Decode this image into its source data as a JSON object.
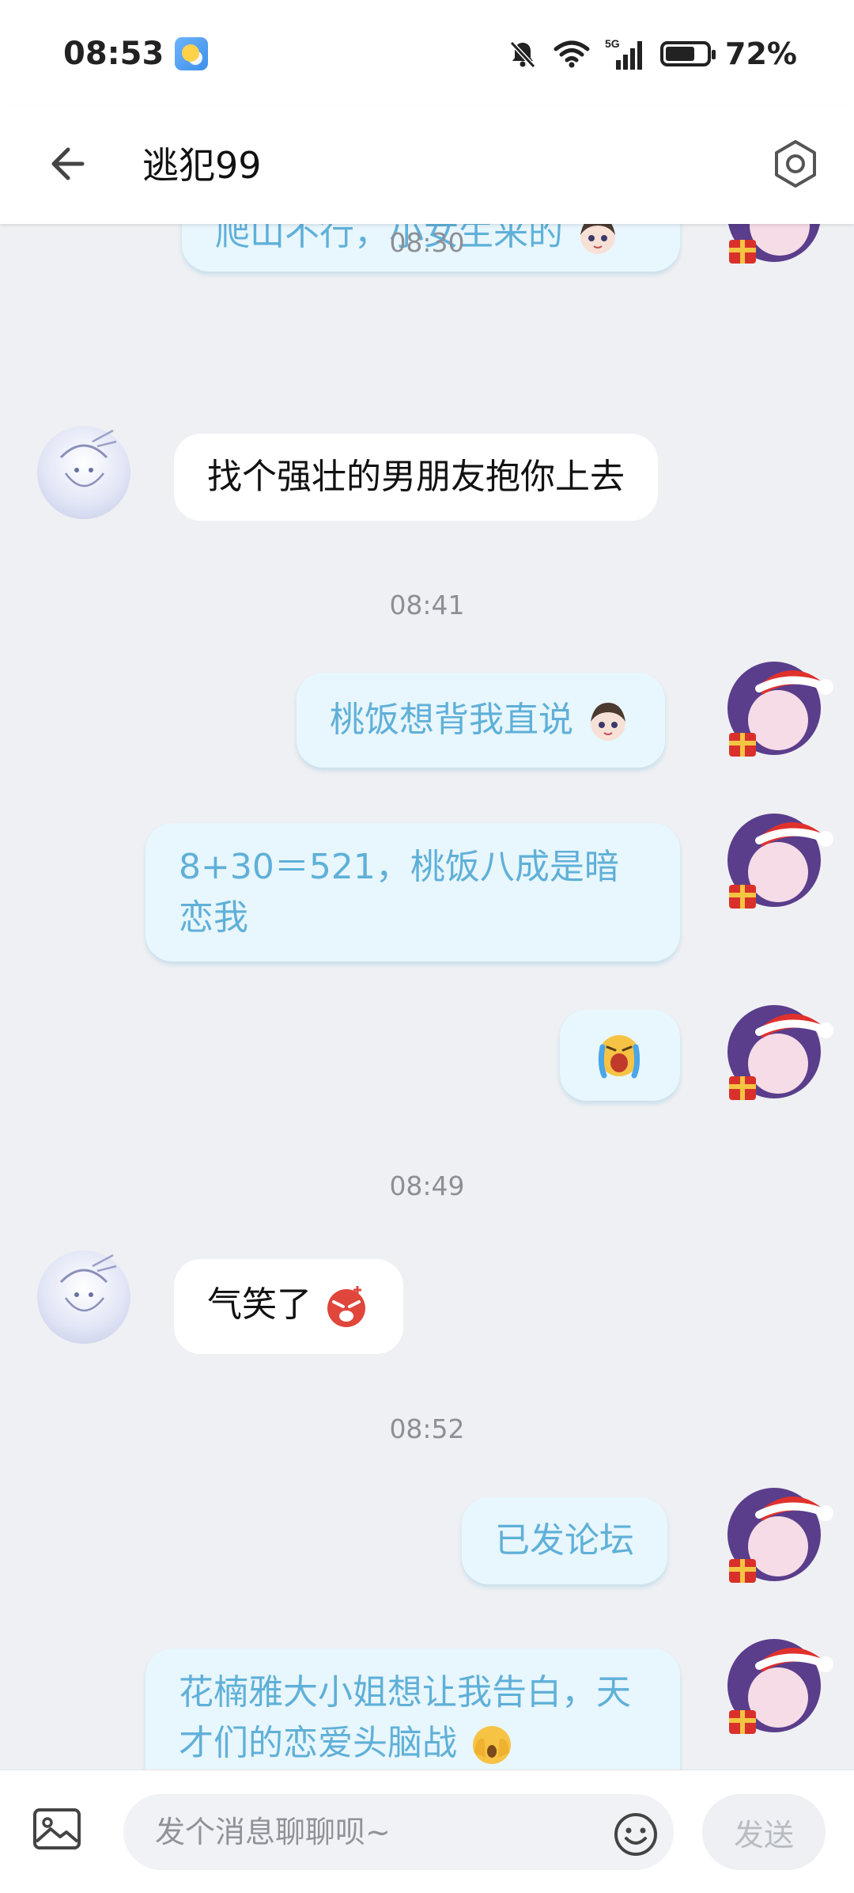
{
  "status_bar": {
    "time": "08:53",
    "battery": "72%",
    "battery_level": 0.72,
    "icons": [
      "weather-icon",
      "mute-icon",
      "wifi-icon",
      "signal-5g-icon",
      "battery-icon"
    ]
  },
  "header": {
    "title": "逃犯99",
    "back_icon": "back-arrow-icon",
    "settings_icon": "settings-hexagon-icon"
  },
  "messages": [
    {
      "side": "out",
      "text": "爬山不行，小女生来的",
      "emoji": "anime-girl-sticker"
    },
    {
      "type": "time",
      "text": "08:30"
    },
    {
      "side": "in",
      "text": "找个强壮的男朋友抱你上去"
    },
    {
      "type": "time",
      "text": "08:41"
    },
    {
      "side": "out",
      "text": "桃饭想背我直说",
      "emoji": "anime-girl-sticker"
    },
    {
      "side": "out",
      "text": "8+30＝521，桃饭八成是暗恋我"
    },
    {
      "side": "out",
      "text": "",
      "emoji": "crying-face-sticker"
    },
    {
      "type": "time",
      "text": "08:49"
    },
    {
      "side": "in",
      "text": "气笑了",
      "emoji": "angry-face-sticker"
    },
    {
      "type": "time",
      "text": "08:52"
    },
    {
      "side": "out",
      "text": "已发论坛"
    },
    {
      "side": "out",
      "text": "花楠雅大小姐想让我告白，天才们的恋爱头脑战",
      "emoji": "covering-face-emoji"
    }
  ],
  "input": {
    "placeholder": "发个消息聊聊呗~",
    "send_label": "发送"
  },
  "colors": {
    "outgoing_bubble": "#e8f6fd",
    "outgoing_text": "#5fb0d8",
    "incoming_bubble": "#ffffff",
    "background": "#eff0f3"
  }
}
